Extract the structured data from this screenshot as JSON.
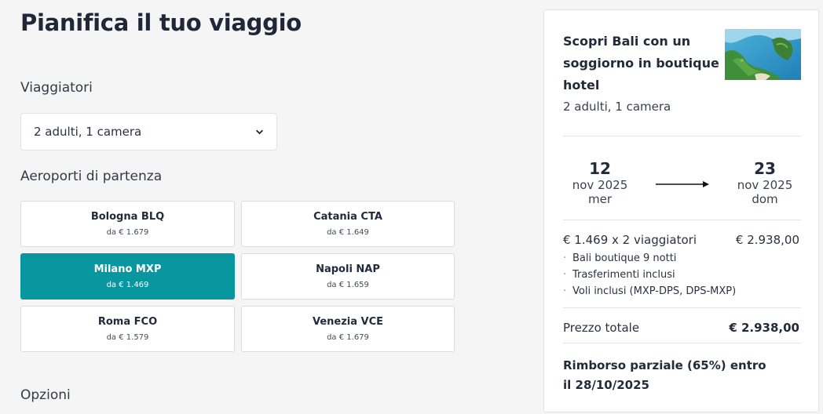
{
  "page": {
    "title": "Pianifica il tuo viaggio"
  },
  "travellers": {
    "label": "Viaggiatori",
    "value": "2 adulti, 1 camera"
  },
  "airports": {
    "label": "Aeroporti di partenza",
    "items": [
      {
        "name": "Bologna BLQ",
        "price": "da € 1.679",
        "selected": false
      },
      {
        "name": "Catania CTA",
        "price": "da € 1.649",
        "selected": false
      },
      {
        "name": "Milano MXP",
        "price": "da € 1.469",
        "selected": true
      },
      {
        "name": "Napoli NAP",
        "price": "da € 1.659",
        "selected": false
      },
      {
        "name": "Roma FCO",
        "price": "da € 1.579",
        "selected": false
      },
      {
        "name": "Venezia VCE",
        "price": "da € 1.679",
        "selected": false
      }
    ]
  },
  "options": {
    "label": "Opzioni"
  },
  "summary": {
    "title": "Scopri Bali con un soggiorno in boutique hotel",
    "subtitle": "2 adulti, 1 camera",
    "image_icon": "bali-coast-thumbnail",
    "checkin": {
      "day": "12",
      "month": "nov 2025",
      "weekday": "mer"
    },
    "checkout": {
      "day": "23",
      "month": "nov 2025",
      "weekday": "dom"
    },
    "price_line": "€ 1.469 x 2 viaggiatori",
    "price_amount": "€ 2.938,00",
    "bullets": [
      "Bali boutique 9 notti",
      "Trasferimenti inclusi",
      "Voli inclusi (MXP-DPS, DPS-MXP)"
    ],
    "total_label": "Prezzo totale",
    "total_amount": "€ 2.938,00",
    "refund": "Rimborso parziale (65%) entro il 28/10/2025"
  },
  "colors": {
    "accent": "#08969f",
    "text": "#222b3a",
    "background": "#f5f5f5"
  }
}
